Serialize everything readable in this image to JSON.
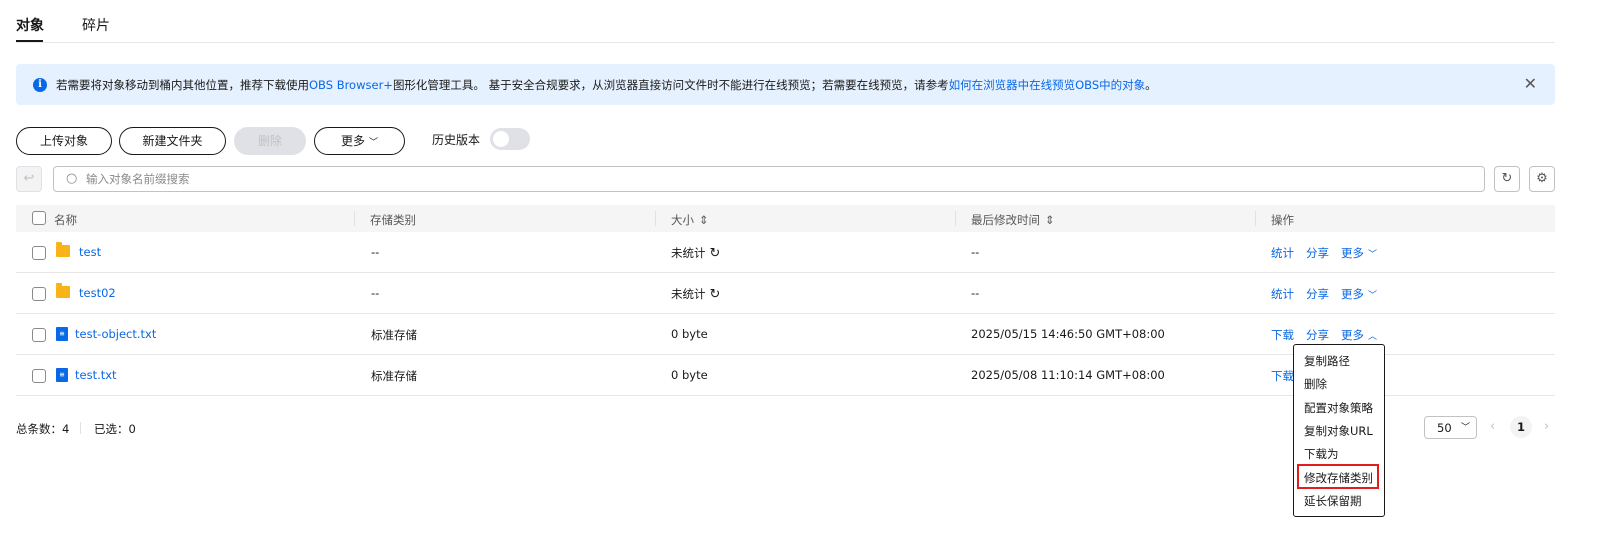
{
  "tabs": [
    {
      "label": "对象"
    },
    {
      "label": "碎片"
    }
  ],
  "notice": {
    "text1": "若需要将对象移动到桶内其他位置，推荐下载使用",
    "link1": "OBS Browser+",
    "text2": "图形化管理工具。 基于安全合规要求，从浏览器直接访问文件时不能进行在线预览；若需要在线预览，请参考",
    "link2": "如何在浏览器中在线预览OBS中的对象",
    "text3": "。"
  },
  "toolbar": {
    "upload": "上传对象",
    "new_folder": "新建文件夹",
    "delete": "删除",
    "more": "更多",
    "history": "历史版本",
    "history_enabled": false
  },
  "search": {
    "placeholder": "输入对象名前缀搜索"
  },
  "table": {
    "headers": {
      "name": "名称",
      "storage": "存储类别",
      "size": "大小",
      "modified": "最后修改时间",
      "actions": "操作"
    },
    "rows": [
      {
        "name": "test",
        "type": "folder",
        "storage": "--",
        "size": "未统计",
        "modified": "--",
        "a1": "统计",
        "a2": "分享",
        "a3": "更多"
      },
      {
        "name": "test02",
        "type": "folder",
        "storage": "--",
        "size": "未统计",
        "modified": "--",
        "a1": "统计",
        "a2": "分享",
        "a3": "更多"
      },
      {
        "name": "test-object.txt",
        "type": "file",
        "storage": "标准存储",
        "size": "0 byte",
        "modified": "2025/05/15 14:46:50 GMT+08:00",
        "a1": "下载",
        "a2": "分享",
        "a3": "更多"
      },
      {
        "name": "test.txt",
        "type": "file",
        "storage": "标准存储",
        "size": "0 byte",
        "modified": "2025/05/08 11:10:14 GMT+08:00",
        "a1": "下载",
        "a2": "",
        "a3": ""
      }
    ]
  },
  "footer": {
    "total_label": "总条数：",
    "total": "4",
    "selected_label": "已选：",
    "selected": "0"
  },
  "pagination": {
    "page_size": "50",
    "current_page": "1"
  },
  "dropdown": {
    "items": [
      "复制路径",
      "删除",
      "配置对象策略",
      "复制对象URL",
      "下载为",
      "修改存储类别",
      "延长保留期"
    ],
    "highlighted_index": 5
  },
  "colors": {
    "link": "#0968e5",
    "notice_bg": "#e6f1ff",
    "folder": "#f8b318",
    "highlight": "#e21d1d"
  }
}
